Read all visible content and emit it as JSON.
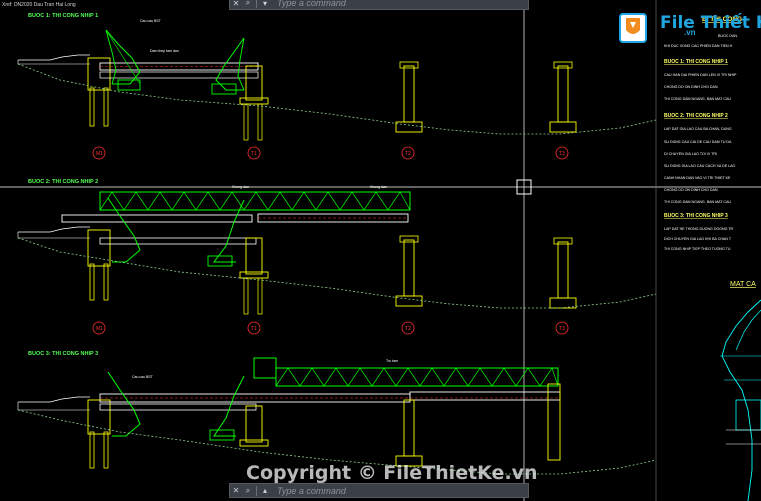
{
  "app": {
    "xref_label": "Xref: DN2020 Dau Tran Hai Long"
  },
  "command_line": {
    "top_placeholder": "Type a command",
    "bottom_placeholder": "Type a command",
    "close_icon": "close-icon",
    "search_icon": "search-icon",
    "dropdown_icon": "chevron-up-icon"
  },
  "drawing": {
    "step_titles": [
      "BUOC 1: THI CONG NHIP 1",
      "BUOC 2: THI CONG NHIP 2",
      "BUOC 3: THI CONG NHIP 3"
    ],
    "pier_labels": [
      "M1",
      "T1",
      "T2",
      "T3"
    ],
    "annotations": {
      "crane": "Cau cau BST",
      "girder": "Dam thep tam dan",
      "truss_left": "Khung dan",
      "truss_right": "Khung dan",
      "temp_support": "Tru tam"
    },
    "notes_title_partial": "BI THI CONG",
    "notes": [
      {
        "heading": "",
        "lines": [
          "BUOC DAN.",
          "KHI DUC XONG CAC PHIEN DAN TIEN H"
        ]
      },
      {
        "heading": "BUOC 1: THI CONG NHIP 1",
        "lines": [
          "CAU HAN DAI PHIEN DAN LEN VI TRI NHIP",
          "CHONG DO ON DINH CHO DAN.",
          "THI CONG DAM NGANG, BAN MAT CAU"
        ]
      },
      {
        "heading": "BUOC 2: THI CONG NHIP 2",
        "lines": [
          "LAP DAT GIA LAO CAU BA CHAN, DUNG",
          "SU DUNG CAU CAI DE CAU DAM TU DA",
          "DI CHUYEN GIA LAO TOI VI TRI",
          "SU DUNG GIA LAO CAU CACH XA DE LAO",
          "CANH NHAN DAN VAO VI TRI THIET KE",
          "CHONG DO ON DINH CHO DAN.",
          "THI CONG DAM NGANG, BAN MAT CAU"
        ]
      },
      {
        "heading": "BUOC 3: THI CONG NHIP 3",
        "lines": [
          "LAP DAT HE THONG DUONG DOONG TR",
          "DICH CHUYEN GIA LAO KHI BA CHAN T",
          "THI CONG NHIP TIEP THEO TUONG TU"
        ]
      }
    ],
    "section_label_partial": "MAT CA"
  },
  "branding": {
    "logo_text": "File Thiết Kế",
    "logo_sub": ".vn",
    "watermark": "Copyright © FileThietKe.vn"
  },
  "colors": {
    "background": "#000000",
    "structure": "#ffff00",
    "crane": "#00ff00",
    "girder": "#ffffff",
    "dim_line": "#ff0000",
    "ground": "#8fd18f",
    "notes_heading": "#ffff66",
    "notes_text": "#ffffff"
  }
}
